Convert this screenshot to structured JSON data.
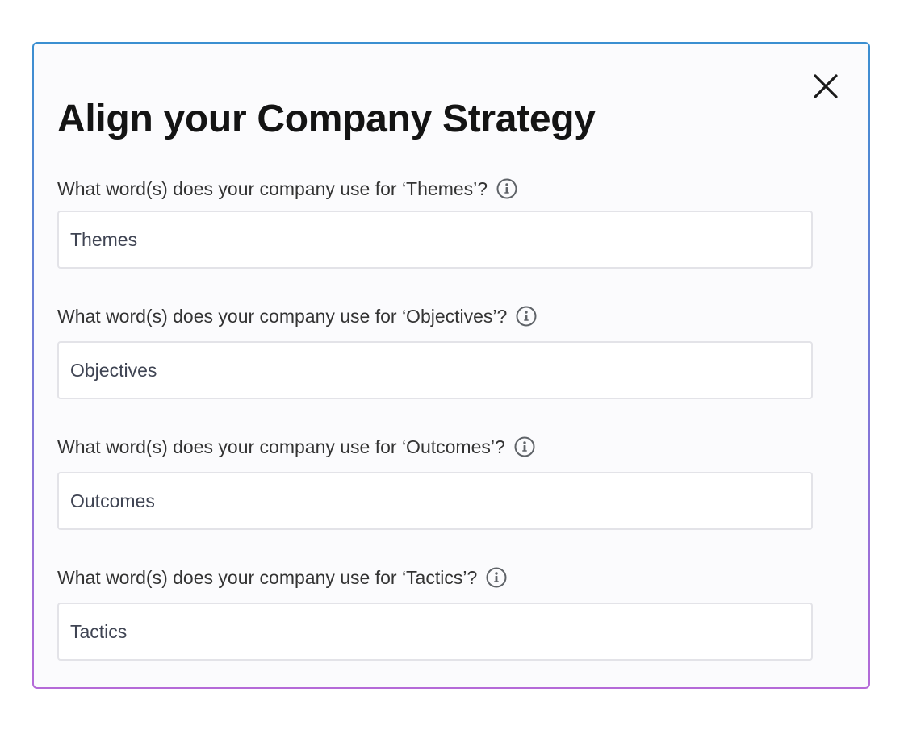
{
  "dialog": {
    "title": "Align your Company Strategy",
    "close_icon": "close-icon"
  },
  "fields": [
    {
      "label": "What word(s) does your company use for ‘Themes’?",
      "value": "Themes",
      "info_icon": "info-icon"
    },
    {
      "label": "What word(s) does your company use for ‘Objectives’?",
      "value": "Objectives",
      "info_icon": "info-icon"
    },
    {
      "label": "What word(s) does your company use for ‘Outcomes’?",
      "value": "Outcomes",
      "info_icon": "info-icon"
    },
    {
      "label": "What word(s) does your company use for ‘Tactics’?",
      "value": "Tactics",
      "info_icon": "info-icon"
    }
  ],
  "colors": {
    "border_gradient_top": "#3b8fd1",
    "border_gradient_bottom": "#b56ad8",
    "panel_background": "#fbfbfd",
    "input_border": "#e3e3e8",
    "title_text": "#141414"
  }
}
